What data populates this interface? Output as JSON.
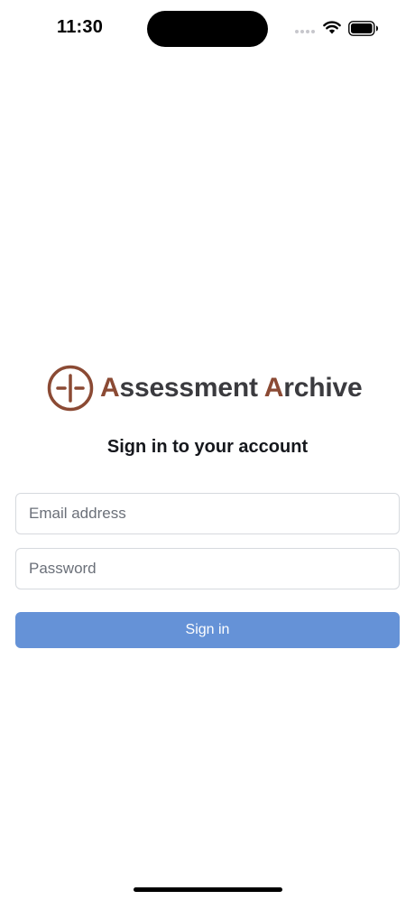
{
  "status_bar": {
    "time": "11:30"
  },
  "brand": {
    "name_part1_initial": "A",
    "name_part1_rest": "ssessment ",
    "name_part2_initial": "A",
    "name_part2_rest": "rchive",
    "accent_color": "#8b4a34",
    "logo_icon": "circle-crosshair-logo"
  },
  "heading": "Sign in to your account",
  "form": {
    "email_placeholder": "Email address",
    "email_value": "",
    "password_placeholder": "Password",
    "password_value": "",
    "submit_label": "Sign in",
    "submit_color": "#6592d7"
  }
}
